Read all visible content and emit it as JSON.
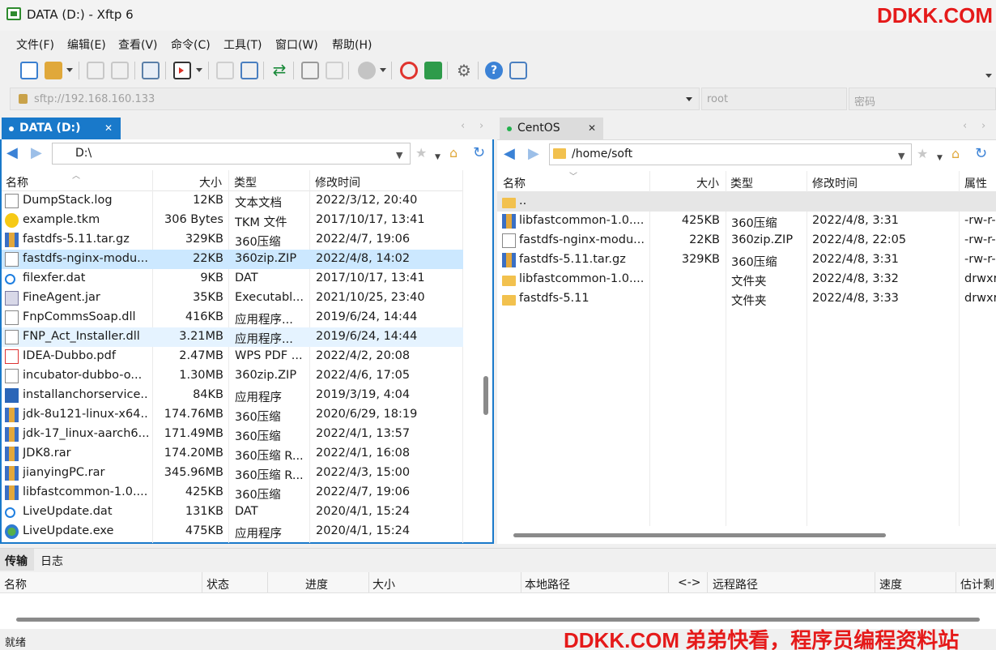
{
  "window": {
    "title": "DATA (D:)  - Xftp 6"
  },
  "watermark": {
    "top": "DDKK.COM",
    "bottom": "DDKK.COM 弟弟快看，程序员编程资料站"
  },
  "menu": [
    "文件(F)",
    "编辑(E)",
    "查看(V)",
    "命令(C)",
    "工具(T)",
    "窗口(W)",
    "帮助(H)"
  ],
  "address": {
    "host_placeholder": "sftp://192.168.160.133",
    "user_placeholder": "root",
    "password_placeholder": "密码"
  },
  "left": {
    "tab_label": "DATA (D:)",
    "path": "D:\\",
    "columns": [
      "名称",
      "大小",
      "类型",
      "修改时间"
    ],
    "rows": [
      {
        "name": "DumpStack.log",
        "size": "12KB",
        "type": "文本文档",
        "modified": "2022/3/12, 20:40",
        "icon": "doc"
      },
      {
        "name": "example.tkm",
        "size": "306 Bytes",
        "type": "TKM 文件",
        "modified": "2017/10/17, 13:41",
        "icon": "tkm"
      },
      {
        "name": "fastdfs-5.11.tar.gz",
        "size": "329KB",
        "type": "360压缩",
        "modified": "2022/4/7, 19:06",
        "icon": "rar"
      },
      {
        "name": "fastdfs-nginx-modu...",
        "size": "22KB",
        "type": "360zip.ZIP",
        "modified": "2022/4/8, 14:02",
        "icon": "doc"
      },
      {
        "name": "filexfer.dat",
        "size": "9KB",
        "type": "DAT",
        "modified": "2017/10/17, 13:41",
        "icon": "dat"
      },
      {
        "name": "FineAgent.jar",
        "size": "35KB",
        "type": "Executabl...",
        "modified": "2021/10/25, 23:40",
        "icon": "jar"
      },
      {
        "name": "FnpCommsSoap.dll",
        "size": "416KB",
        "type": "应用程序...",
        "modified": "2019/6/24, 14:44",
        "icon": "doc"
      },
      {
        "name": "FNP_Act_Installer.dll",
        "size": "3.21MB",
        "type": "应用程序...",
        "modified": "2019/6/24, 14:44",
        "icon": "doc"
      },
      {
        "name": "IDEA-Dubbo.pdf",
        "size": "2.47MB",
        "type": "WPS PDF ...",
        "modified": "2022/4/2, 20:08",
        "icon": "pdf"
      },
      {
        "name": "incubator-dubbo-o...",
        "size": "1.30MB",
        "type": "360zip.ZIP",
        "modified": "2022/4/6, 17:05",
        "icon": "doc"
      },
      {
        "name": "installanchorservice...",
        "size": "84KB",
        "type": "应用程序",
        "modified": "2019/3/19, 4:04",
        "icon": "exe"
      },
      {
        "name": "jdk-8u121-linux-x64...",
        "size": "174.76MB",
        "type": "360压缩",
        "modified": "2020/6/29, 18:19",
        "icon": "rar"
      },
      {
        "name": "jdk-17_linux-aarch6...",
        "size": "171.49MB",
        "type": "360压缩",
        "modified": "2022/4/1, 13:57",
        "icon": "rar"
      },
      {
        "name": "JDK8.rar",
        "size": "174.20MB",
        "type": "360压缩 R...",
        "modified": "2022/4/1, 16:08",
        "icon": "rar"
      },
      {
        "name": "jianyingPC.rar",
        "size": "345.96MB",
        "type": "360压缩 R...",
        "modified": "2022/4/3, 15:00",
        "icon": "rar"
      },
      {
        "name": "libfastcommon-1.0....",
        "size": "425KB",
        "type": "360压缩",
        "modified": "2022/4/7, 19:06",
        "icon": "rar"
      },
      {
        "name": "LiveUpdate.dat",
        "size": "131KB",
        "type": "DAT",
        "modified": "2020/4/1, 15:24",
        "icon": "dat"
      },
      {
        "name": "LiveUpdate.exe",
        "size": "475KB",
        "type": "应用程序",
        "modified": "2020/4/1, 15:24",
        "icon": "globe"
      }
    ]
  },
  "right": {
    "tab_label": "CentOS",
    "path": "/home/soft",
    "columns": [
      "名称",
      "大小",
      "类型",
      "修改时间",
      "属性"
    ],
    "rows": [
      {
        "name": "..",
        "size": "",
        "type": "",
        "modified": "",
        "attr": "",
        "icon": "folder"
      },
      {
        "name": "libfastcommon-1.0....",
        "size": "425KB",
        "type": "360压缩",
        "modified": "2022/4/8, 3:31",
        "attr": "-rw-r-",
        "icon": "rar"
      },
      {
        "name": "fastdfs-nginx-modu...",
        "size": "22KB",
        "type": "360zip.ZIP",
        "modified": "2022/4/8, 22:05",
        "attr": "-rw-r-",
        "icon": "doc"
      },
      {
        "name": "fastdfs-5.11.tar.gz",
        "size": "329KB",
        "type": "360压缩",
        "modified": "2022/4/8, 3:31",
        "attr": "-rw-r-",
        "icon": "rar"
      },
      {
        "name": "libfastcommon-1.0....",
        "size": "",
        "type": "文件夹",
        "modified": "2022/4/8, 3:32",
        "attr": "drwxr",
        "icon": "folder"
      },
      {
        "name": "fastdfs-5.11",
        "size": "",
        "type": "文件夹",
        "modified": "2022/4/8, 3:33",
        "attr": "drwxr",
        "icon": "folder"
      }
    ]
  },
  "bottom_tabs": [
    "传输",
    "日志"
  ],
  "transfer_columns": [
    "名称",
    "状态",
    "进度",
    "大小",
    "本地路径",
    "<->",
    "远程路径",
    "速度",
    "估计剩"
  ],
  "status": "就绪",
  "colors": {
    "accent": "#1979ca",
    "selected_row": "#cce8ff",
    "hover_row": "#e5f3ff",
    "watermark": "#e51a1a"
  }
}
